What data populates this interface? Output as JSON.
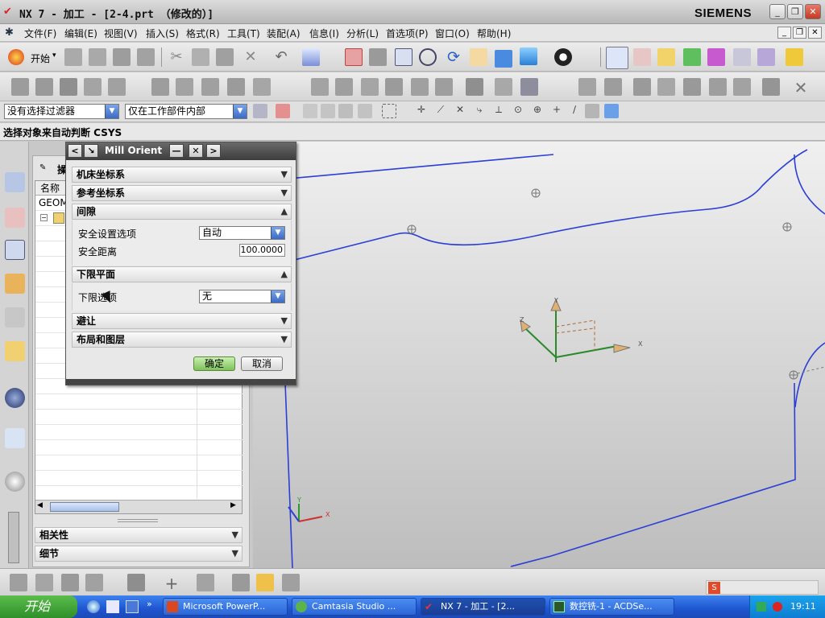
{
  "window": {
    "title": "NX 7 - 加工 - [2-4.prt （修改的）]",
    "brand": "SIEMENS",
    "controls": {
      "minimize": "_",
      "restore": "❐",
      "close": "✕"
    }
  },
  "menubar": {
    "items": [
      "文件(F)",
      "编辑(E)",
      "视图(V)",
      "插入(S)",
      "格式(R)",
      "工具(T)",
      "装配(A)",
      "信息(I)",
      "分析(L)",
      "首选项(P)",
      "窗口(O)",
      "帮助(H)"
    ]
  },
  "toolbar1": {
    "start_label": "开始"
  },
  "filterbar": {
    "type_filter": "没有选择过滤器",
    "scope_filter": "仅在工作部件内部"
  },
  "statusline": {
    "text": "选择对象来自动判断 CSYS"
  },
  "navigator": {
    "header_fragment": "操",
    "column_name": "名称",
    "row_geom": "GEOM",
    "bottom_sections": [
      "相关性",
      "细节"
    ]
  },
  "dialog": {
    "title": "Mill Orient",
    "sections": {
      "mcs": "机床坐标系",
      "ref_csys": "参考坐标系",
      "clearance": "间隙",
      "lower_plane": "下限平面",
      "avoidance": "避让",
      "layout": "布局和图层"
    },
    "clearance": {
      "option_label": "安全设置选项",
      "option_value": "自动",
      "distance_label": "安全距离",
      "distance_value": "100.0000"
    },
    "lower_plane": {
      "option_label": "下限选项",
      "option_value": "无"
    },
    "ok_label": "确定",
    "cancel_label": "取消"
  },
  "graphics": {
    "axis_labels": {
      "x": "X",
      "y": "Y",
      "z": "Z"
    }
  },
  "taskbar": {
    "start_label": "开始",
    "tasks": [
      "Microsoft PowerP...",
      "Camtasia Studio ...",
      "NX 7 - 加工 - [2...",
      "数控铣-1 - ACDSe..."
    ],
    "clock": "19:11"
  },
  "colors": {
    "model_lines": "#2b3fd6",
    "ok_button": "#7ec05a",
    "dialog_title": "#4a4a4a",
    "taskbar": "#2457d1"
  }
}
